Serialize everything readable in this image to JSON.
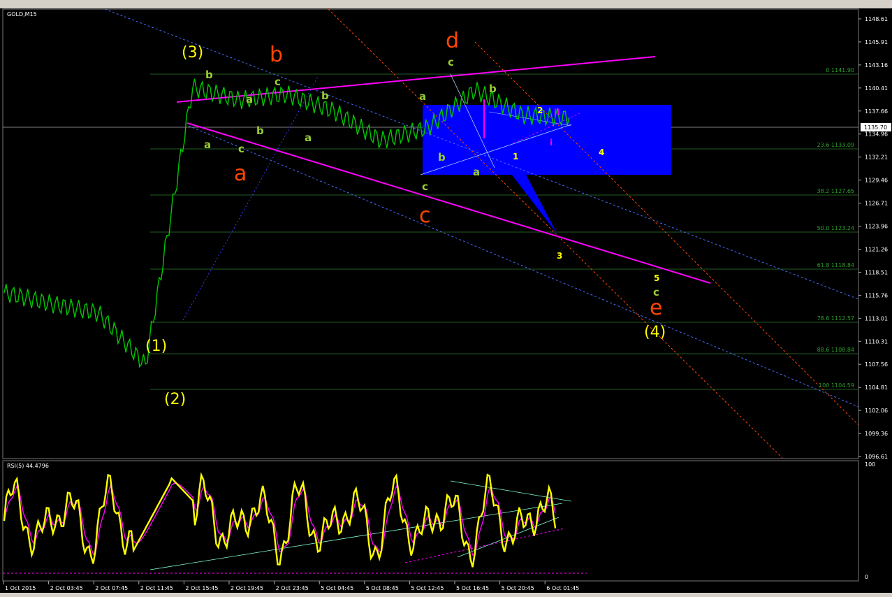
{
  "window": {
    "main_label": "GOLD,M15",
    "rsi_label": "RSI(5) 44.4796",
    "current_price": "1135.70"
  },
  "price_axis": [
    "1148.61",
    "1145.91",
    "1143.16",
    "1140.41",
    "1137.66",
    "1134.96",
    "1132.21",
    "1129.46",
    "1126.71",
    "1123.96",
    "1121.26",
    "1118.51",
    "1115.76",
    "1113.01",
    "1110.31",
    "1107.56",
    "1104.81",
    "1102.06",
    "1099.36",
    "1096.61"
  ],
  "rsi_axis": [
    "100",
    "0"
  ],
  "time_axis": [
    "1 Oct 2015",
    "2 Oct 03:45",
    "2 Oct 07:45",
    "2 Oct 11:45",
    "2 Oct 15:45",
    "2 Oct 19:45",
    "2 Oct 23:45",
    "5 Oct 04:45",
    "5 Oct 08:45",
    "5 Oct 12:45",
    "5 Oct 16:45",
    "5 Oct 20:45",
    "6 Oct 01:45"
  ],
  "fib_levels": [
    "0 1141.90",
    "23.6 1133.09",
    "38.2 1127.65",
    "50.0 1123.24",
    "61.8 1118.84",
    "78.6 1112.57",
    "88.6 1108.84",
    "100 1104.59"
  ],
  "labels": {
    "w1": "(1)",
    "w2": "(2)",
    "w3": "(3)",
    "w4": "(4)",
    "big_a": "a",
    "big_b": "b",
    "big_c": "c",
    "big_d": "d",
    "big_e": "e",
    "s_b1": "b",
    "s_a1": "a",
    "s_c1": "c",
    "s_b2": "b",
    "s_a2": "a",
    "s_c2": "c",
    "s_b3": "b",
    "s_a3": "a",
    "s_b4": "b",
    "s_a4": "a",
    "s_c3": "c",
    "s_b5": "b",
    "s_c4": "c",
    "s_a5": "a",
    "s_b6": "b",
    "n1": "1",
    "n2": "2",
    "n3": "3",
    "n4": "4",
    "n5": "5",
    "c5": "c",
    "r_ii": "ii",
    "r_i": "i"
  },
  "colors": {
    "candle": "#00c800",
    "trend": "#ff00ff",
    "fib": "#2e7d2e",
    "box": "#0000ff",
    "rsi": "#ffff00",
    "rsi_ma": "#ff00ff",
    "wave_major": "#ffff00",
    "wave_orange": "#ff4500",
    "wave_minor": "#9acd32"
  },
  "chart_data": {
    "type": "line",
    "title": "GOLD,M15",
    "x": [
      "1 Oct 2015",
      "2 Oct 03:45",
      "2 Oct 07:45",
      "2 Oct 11:45",
      "2 Oct 15:45",
      "2 Oct 19:45",
      "2 Oct 23:45",
      "5 Oct 04:45",
      "5 Oct 08:45",
      "5 Oct 12:45",
      "5 Oct 16:45",
      "5 Oct 20:45",
      "6 Oct 01:45"
    ],
    "series": [
      {
        "values": [
          1114.9,
          1113.6,
          1112.5,
          1106.3,
          1139.3,
          1137.8,
          1138.5,
          1136.5,
          1133.0,
          1134.5,
          1139.0,
          1136.0,
          1135.7
        ]
      }
    ],
    "ylim": [
      1096.61,
      1148.61
    ],
    "rsi_ylim": [
      0,
      100
    ]
  }
}
